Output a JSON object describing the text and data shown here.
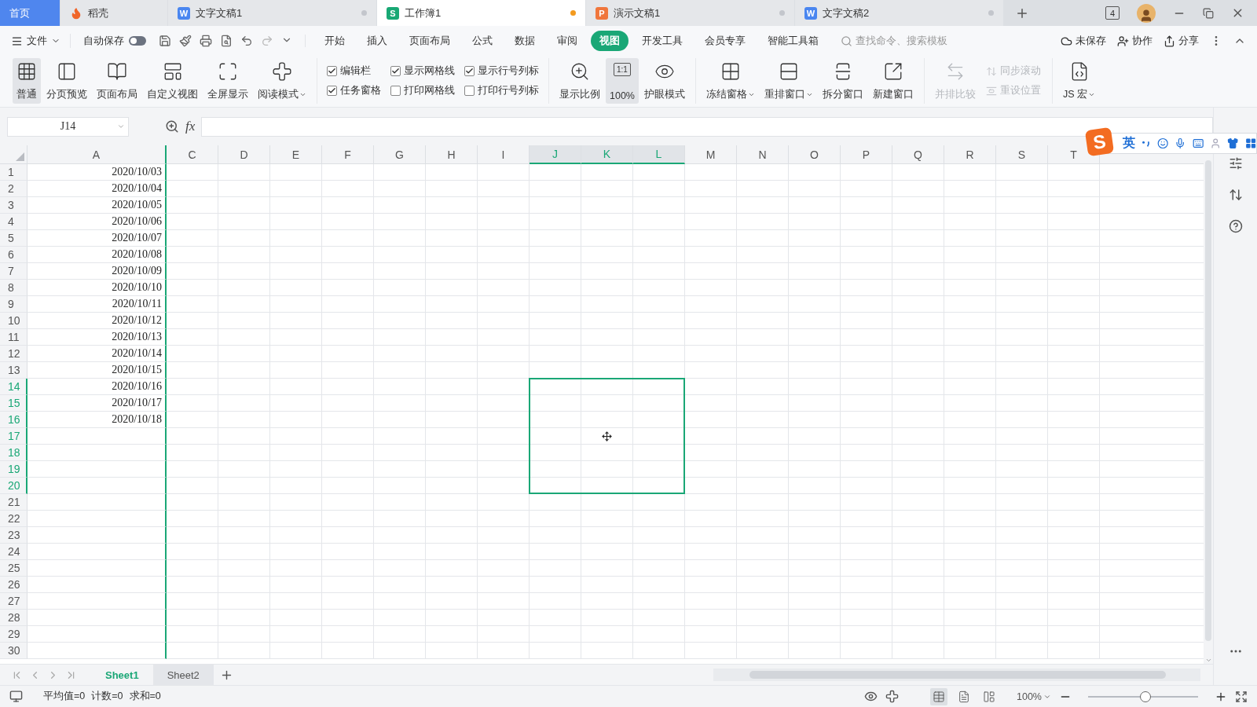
{
  "tabs": [
    {
      "label": "首页",
      "kind": "home",
      "selected": false
    },
    {
      "label": "稻壳",
      "kind": "docer",
      "selected": false
    },
    {
      "label": "文字文稿1",
      "kind": "document",
      "letter": "W",
      "color": "#4a86f0",
      "selected": false,
      "modified": false
    },
    {
      "label": "工作簿1",
      "kind": "document",
      "letter": "S",
      "color": "#18a874",
      "selected": true,
      "modified": true
    },
    {
      "label": "演示文稿1",
      "kind": "document",
      "letter": "P",
      "color": "#f0763c",
      "selected": false,
      "modified": false
    },
    {
      "label": "文字文稿2",
      "kind": "document",
      "letter": "W",
      "color": "#4a86f0",
      "selected": false,
      "modified": false
    }
  ],
  "window_controls": {
    "tab_count": "4"
  },
  "menu": {
    "file": "文件",
    "autosave": {
      "label": "自动保存",
      "on": false
    },
    "tabs": [
      {
        "label": "开始",
        "selected": false
      },
      {
        "label": "插入",
        "selected": false
      },
      {
        "label": "页面布局",
        "selected": false
      },
      {
        "label": "公式",
        "selected": false
      },
      {
        "label": "数据",
        "selected": false
      },
      {
        "label": "审阅",
        "selected": false
      },
      {
        "label": "视图",
        "selected": true
      },
      {
        "label": "开发工具",
        "selected": false
      },
      {
        "label": "会员专享",
        "selected": false
      },
      {
        "label": "智能工具箱",
        "selected": false
      }
    ],
    "search": {
      "placeholder": "查找命令、搜索模板"
    },
    "actions": [
      "未保存",
      "协作",
      "分享"
    ]
  },
  "ribbon": [
    {
      "items": [
        {
          "kind": "large",
          "label": "普通",
          "selected": true,
          "disabled": false
        },
        {
          "kind": "large",
          "label": "分页预览",
          "selected": false,
          "disabled": false
        },
        {
          "kind": "large",
          "label": "页面布局",
          "selected": false,
          "disabled": false
        },
        {
          "kind": "large",
          "label": "自定义视图",
          "selected": false,
          "disabled": false
        },
        {
          "kind": "large",
          "label": "全屏显示",
          "selected": false,
          "disabled": false
        },
        {
          "kind": "large",
          "label": "阅读模式",
          "selected": false,
          "disabled": false,
          "dropdown": true
        }
      ]
    },
    {
      "items": [
        {
          "kind": "checkbox",
          "label": "编辑栏",
          "checked": true
        },
        {
          "kind": "checkbox",
          "label": "显示网格线",
          "checked": true
        },
        {
          "kind": "checkbox",
          "label": "显示行号列标",
          "checked": true
        },
        {
          "kind": "checkbox",
          "label": "任务窗格",
          "checked": true
        },
        {
          "kind": "checkbox",
          "label": "打印网格线",
          "checked": false
        },
        {
          "kind": "checkbox",
          "label": "打印行号列标",
          "checked": false
        }
      ]
    },
    {
      "items": [
        {
          "kind": "large",
          "label": "显示比例",
          "selected": false,
          "disabled": false
        },
        {
          "kind": "large",
          "label": "100%",
          "icon_text": "1:1",
          "selected": true,
          "disabled": false
        },
        {
          "kind": "large",
          "label": "护眼模式",
          "selected": false,
          "disabled": false
        }
      ]
    },
    {
      "items": [
        {
          "kind": "large",
          "label": "冻结窗格",
          "selected": false,
          "disabled": false,
          "dropdown": true
        },
        {
          "kind": "large",
          "label": "重排窗口",
          "selected": false,
          "disabled": false,
          "dropdown": true
        },
        {
          "kind": "large",
          "label": "拆分窗口",
          "selected": false,
          "disabled": false
        },
        {
          "kind": "large",
          "label": "新建窗口",
          "selected": false,
          "disabled": false
        }
      ]
    },
    {
      "items": [
        {
          "kind": "large",
          "label": "并排比较",
          "selected": false,
          "disabled": true
        },
        {
          "kind": "small",
          "label": "同步滚动",
          "disabled": true
        },
        {
          "kind": "small",
          "label": "重设位置",
          "disabled": true
        }
      ]
    },
    {
      "items": [
        {
          "kind": "large",
          "label": "JS 宏",
          "selected": false,
          "disabled": false,
          "dropdown": true
        }
      ]
    }
  ],
  "formula_bar": {
    "name_box": "J14",
    "function_label": "fx"
  },
  "ime_bar": {
    "logo": "S",
    "mode": "英"
  },
  "sheet": {
    "columns": [
      {
        "label": "A",
        "selected": false
      },
      {
        "label": "C",
        "selected": false
      },
      {
        "label": "D",
        "selected": false
      },
      {
        "label": "E",
        "selected": false
      },
      {
        "label": "F",
        "selected": false
      },
      {
        "label": "G",
        "selected": false
      },
      {
        "label": "H",
        "selected": false
      },
      {
        "label": "I",
        "selected": false
      },
      {
        "label": "J",
        "selected": true
      },
      {
        "label": "K",
        "selected": true
      },
      {
        "label": "L",
        "selected": true
      },
      {
        "label": "M",
        "selected": false
      },
      {
        "label": "N",
        "selected": false
      },
      {
        "label": "O",
        "selected": false
      },
      {
        "label": "P",
        "selected": false
      },
      {
        "label": "Q",
        "selected": false
      },
      {
        "label": "R",
        "selected": false
      },
      {
        "label": "S",
        "selected": false
      },
      {
        "label": "T",
        "selected": false
      }
    ],
    "rows": [
      {
        "label": "1",
        "selected": false,
        "cells": [
          "2020/10/03"
        ]
      },
      {
        "label": "2",
        "selected": false,
        "cells": [
          "2020/10/04"
        ]
      },
      {
        "label": "3",
        "selected": false,
        "cells": [
          "2020/10/05"
        ]
      },
      {
        "label": "4",
        "selected": false,
        "cells": [
          "2020/10/06"
        ]
      },
      {
        "label": "5",
        "selected": false,
        "cells": [
          "2020/10/07"
        ]
      },
      {
        "label": "6",
        "selected": false,
        "cells": [
          "2020/10/08"
        ]
      },
      {
        "label": "7",
        "selected": false,
        "cells": [
          "2020/10/09"
        ]
      },
      {
        "label": "8",
        "selected": false,
        "cells": [
          "2020/10/10"
        ]
      },
      {
        "label": "9",
        "selected": false,
        "cells": [
          "2020/10/11"
        ]
      },
      {
        "label": "10",
        "selected": false,
        "cells": [
          "2020/10/12"
        ]
      },
      {
        "label": "11",
        "selected": false,
        "cells": [
          "2020/10/13"
        ]
      },
      {
        "label": "12",
        "selected": false,
        "cells": [
          "2020/10/14"
        ]
      },
      {
        "label": "13",
        "selected": false,
        "cells": [
          "2020/10/15"
        ]
      },
      {
        "label": "14",
        "selected": true,
        "cells": [
          "2020/10/16"
        ]
      },
      {
        "label": "15",
        "selected": true,
        "cells": [
          "2020/10/17"
        ]
      },
      {
        "label": "16",
        "selected": true,
        "cells": [
          "2020/10/18"
        ]
      },
      {
        "label": "17",
        "selected": true
      },
      {
        "label": "18",
        "selected": true
      },
      {
        "label": "19",
        "selected": true
      },
      {
        "label": "20",
        "selected": true
      },
      {
        "label": "21",
        "selected": false
      },
      {
        "label": "22",
        "selected": false
      },
      {
        "label": "23",
        "selected": false
      },
      {
        "label": "24",
        "selected": false
      },
      {
        "label": "25",
        "selected": false
      },
      {
        "label": "26",
        "selected": false
      },
      {
        "label": "27",
        "selected": false
      },
      {
        "label": "28",
        "selected": false
      },
      {
        "label": "29",
        "selected": false
      },
      {
        "label": "30",
        "selected": false
      }
    ]
  },
  "sheet_tabs": [
    {
      "label": "Sheet1",
      "selected": true
    },
    {
      "label": "Sheet2",
      "selected": false
    }
  ],
  "status_bar": {
    "summary": [
      "平均值=0",
      "计数=0",
      "求和=0"
    ],
    "views": [
      {
        "selected": true
      },
      {
        "selected": false
      },
      {
        "selected": false
      }
    ],
    "zoom": "100%",
    "zoom_slider": {
      "level": 0.52
    }
  }
}
